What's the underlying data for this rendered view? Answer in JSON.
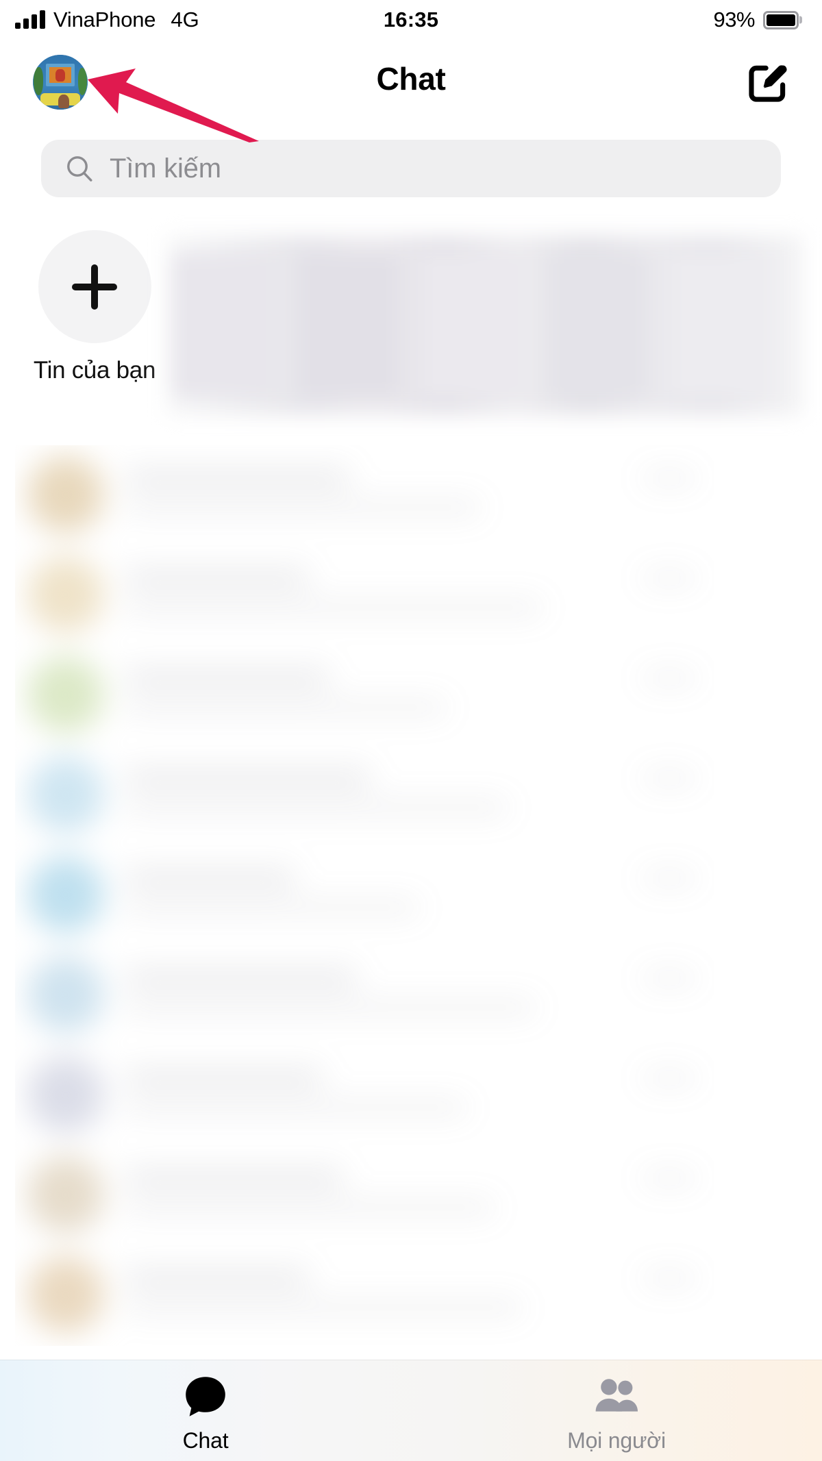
{
  "status_bar": {
    "carrier": "VinaPhone",
    "network": "4G",
    "time": "16:35",
    "battery_percent": "93%",
    "signal_icon": "signal-bars-icon",
    "battery_icon": "battery-full-icon"
  },
  "header": {
    "title": "Chat",
    "avatar_icon": "user-avatar",
    "compose_icon": "compose-icon"
  },
  "annotation": {
    "arrow_icon": "pointer-arrow-icon",
    "color": "#E01A4F",
    "points_to": "user-avatar"
  },
  "search": {
    "placeholder": "Tìm kiếm",
    "value": "",
    "icon": "search-icon",
    "background": "#EFEFF0"
  },
  "stories": {
    "add_story": {
      "label": "Tin của bạn",
      "icon": "plus-icon"
    },
    "hidden_note": "blurred",
    "tiles": [
      {
        "tint": "#e8e6ec"
      },
      {
        "tint": "#e2e0e7"
      },
      {
        "tint": "#ebe9ee"
      },
      {
        "tint": "#e4e3e9"
      },
      {
        "tint": "#edecf0"
      }
    ]
  },
  "chat_list": {
    "hidden_note": "blurred",
    "rows": [
      {
        "avatar_tint": "#e8d8bc",
        "name_width": 330,
        "msg_width": 520
      },
      {
        "avatar_tint": "#efe3c9",
        "name_width": 270,
        "msg_width": 610
      },
      {
        "avatar_tint": "#dce9c7",
        "name_width": 300,
        "msg_width": 470
      },
      {
        "avatar_tint": "#cfe6f2",
        "name_width": 360,
        "msg_width": 560
      },
      {
        "avatar_tint": "#bfe0ef",
        "name_width": 250,
        "msg_width": 430
      },
      {
        "avatar_tint": "#cfe3ef",
        "name_width": 340,
        "msg_width": 600
      },
      {
        "avatar_tint": "#dbdde8",
        "name_width": 290,
        "msg_width": 500
      },
      {
        "avatar_tint": "#e6dccb",
        "name_width": 320,
        "msg_width": 540
      },
      {
        "avatar_tint": "#ead9c0",
        "name_width": 270,
        "msg_width": 580
      }
    ]
  },
  "tab_bar": {
    "tabs": [
      {
        "label": "Chat",
        "icon": "chat-bubble-icon",
        "active": true
      },
      {
        "label": "Mọi người",
        "icon": "people-icon",
        "active": false
      }
    ]
  }
}
